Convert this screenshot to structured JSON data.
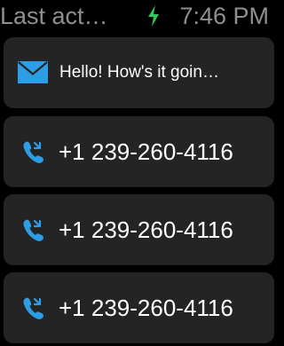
{
  "status_bar": {
    "title": "Last act…",
    "time": "7:46 PM",
    "charging_icon": "bolt-icon",
    "charging_color": "#34c759"
  },
  "items": [
    {
      "type": "message",
      "icon": "mail-icon",
      "text": "Hello! How's it goin…"
    },
    {
      "type": "call",
      "icon": "phone-icon",
      "text": "+1 239-260-4116"
    },
    {
      "type": "call",
      "icon": "phone-icon",
      "text": "+1 239-260-4116"
    },
    {
      "type": "call",
      "icon": "phone-icon",
      "text": "+1 239-260-4116"
    }
  ],
  "colors": {
    "background": "#000000",
    "row_background": "#242424",
    "accent_blue": "#2d9ee6",
    "status_text": "#8e8e93",
    "text": "#ffffff"
  }
}
